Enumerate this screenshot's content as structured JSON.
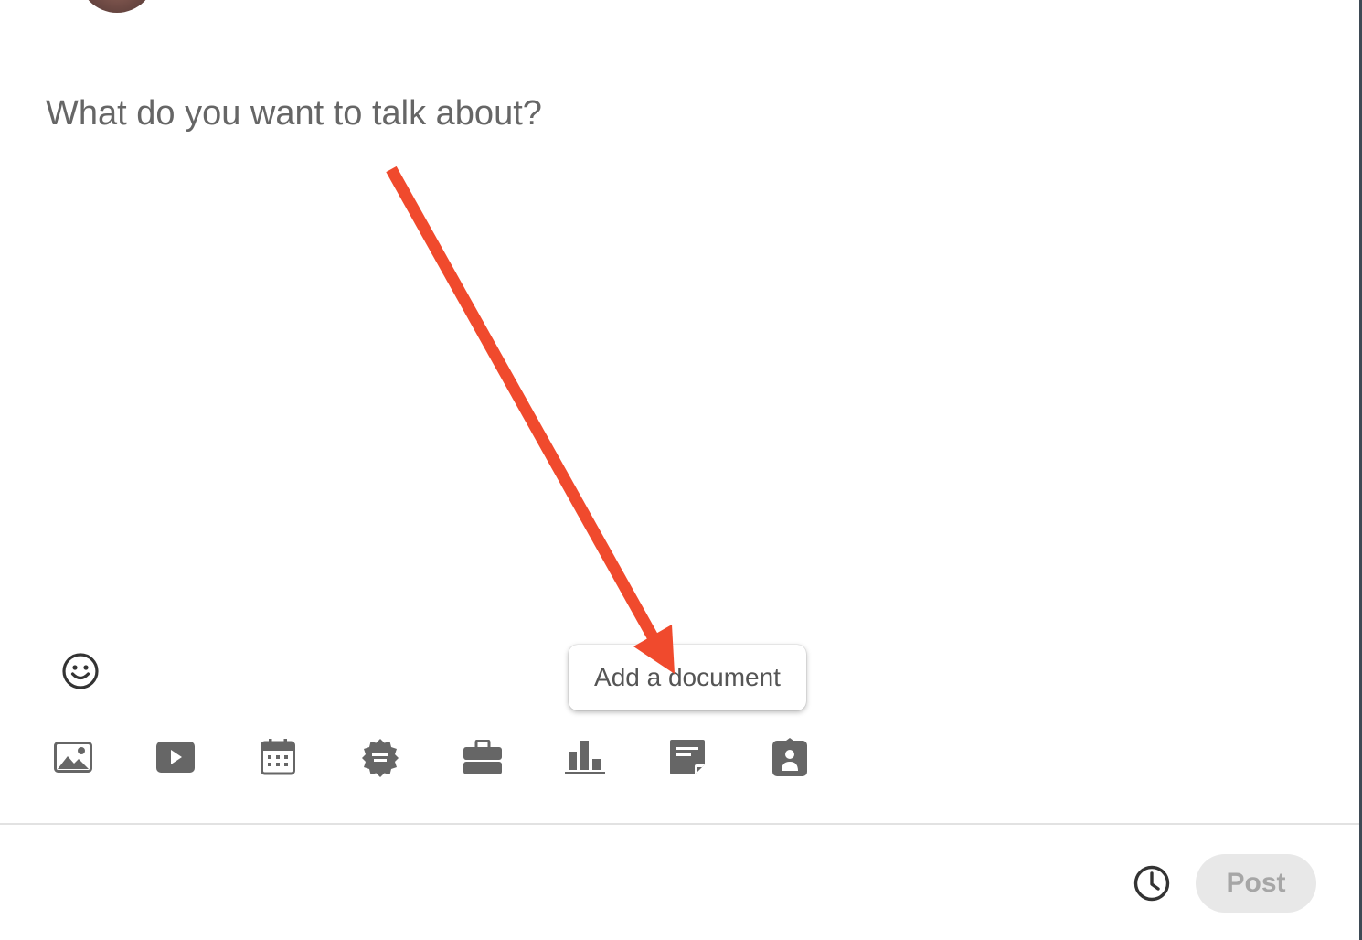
{
  "composer": {
    "placeholder": "What do you want to talk about?"
  },
  "toolbar": {
    "items": [
      {
        "icon": "photo-icon"
      },
      {
        "icon": "video-icon"
      },
      {
        "icon": "calendar-event-icon"
      },
      {
        "icon": "celebrate-badge-icon"
      },
      {
        "icon": "job-briefcase-icon"
      },
      {
        "icon": "poll-chart-icon"
      },
      {
        "icon": "document-icon"
      },
      {
        "icon": "service-profile-icon"
      }
    ]
  },
  "tooltip": {
    "text": "Add a document"
  },
  "footer": {
    "schedule_icon": "clock-icon",
    "post_label": "Post"
  },
  "colors": {
    "icon": "#666666",
    "annotation_arrow": "#f04a2d",
    "post_bg": "#e8e8e8",
    "post_text": "#a6a6a6"
  }
}
